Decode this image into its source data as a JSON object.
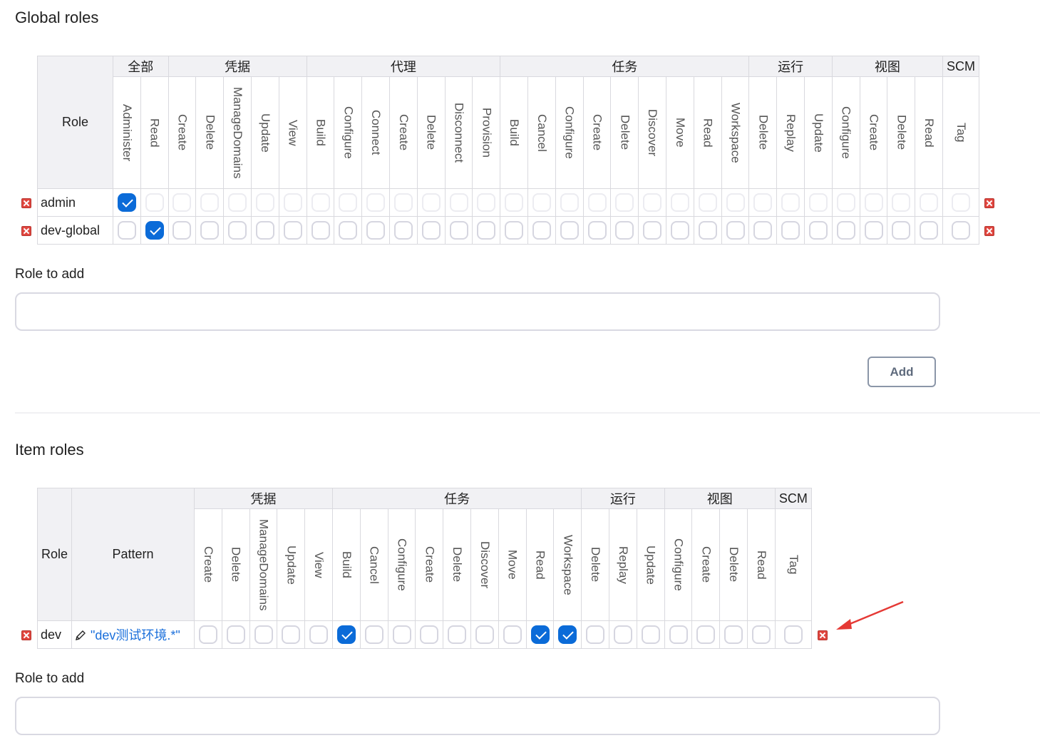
{
  "global": {
    "title": "Global roles",
    "role_header": "Role",
    "groups": [
      {
        "label": "全部",
        "perms": [
          "Administer",
          "Read"
        ]
      },
      {
        "label": "凭据",
        "perms": [
          "Create",
          "Delete",
          "ManageDomains",
          "Update",
          "View"
        ]
      },
      {
        "label": "代理",
        "perms": [
          "Build",
          "Configure",
          "Connect",
          "Create",
          "Delete",
          "Disconnect",
          "Provision"
        ]
      },
      {
        "label": "任务",
        "perms": [
          "Build",
          "Cancel",
          "Configure",
          "Create",
          "Delete",
          "Discover",
          "Move",
          "Read",
          "Workspace"
        ]
      },
      {
        "label": "运行",
        "perms": [
          "Delete",
          "Replay",
          "Update"
        ]
      },
      {
        "label": "视图",
        "perms": [
          "Configure",
          "Create",
          "Delete",
          "Read"
        ]
      },
      {
        "label": "SCM",
        "perms": [
          "Tag"
        ]
      }
    ],
    "rows": [
      {
        "name": "admin",
        "checked": [
          0
        ]
      },
      {
        "name": "dev-global",
        "checked": [
          1
        ]
      }
    ],
    "role_to_add_label": "Role to add",
    "role_to_add_value": "",
    "add_button": "Add"
  },
  "item": {
    "title": "Item roles",
    "role_header": "Role",
    "pattern_header": "Pattern",
    "groups": [
      {
        "label": "凭据",
        "perms": [
          "Create",
          "Delete",
          "ManageDomains",
          "Update",
          "View"
        ]
      },
      {
        "label": "任务",
        "perms": [
          "Build",
          "Cancel",
          "Configure",
          "Create",
          "Delete",
          "Discover",
          "Move",
          "Read",
          "Workspace"
        ]
      },
      {
        "label": "运行",
        "perms": [
          "Delete",
          "Replay",
          "Update"
        ]
      },
      {
        "label": "视图",
        "perms": [
          "Configure",
          "Create",
          "Delete",
          "Read"
        ]
      },
      {
        "label": "SCM",
        "perms": [
          "Tag"
        ]
      }
    ],
    "rows": [
      {
        "name": "dev",
        "pattern": "\"dev测试环境.*\"",
        "checked": [
          5,
          12,
          13
        ]
      }
    ],
    "role_to_add_label": "Role to add",
    "role_to_add_value": ""
  },
  "colors": {
    "accent": "#0b6bd8",
    "delete": "#e0463f",
    "annotation_arrow": "#e53935"
  },
  "icons": [
    "delete-icon",
    "pencil-icon",
    "checkmark-icon"
  ]
}
